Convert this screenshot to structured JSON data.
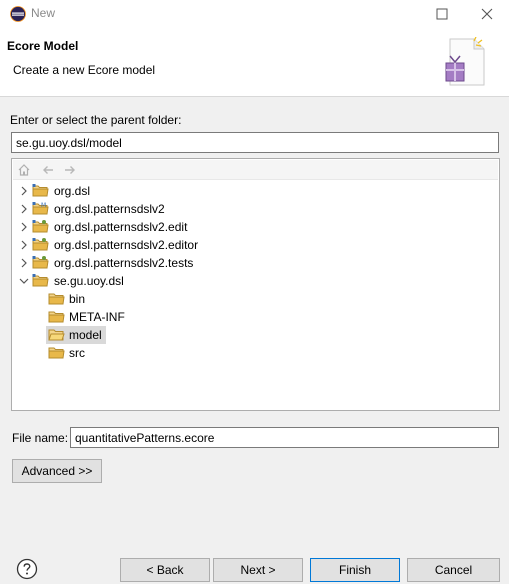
{
  "window": {
    "title": "New",
    "icons": [
      "eclipse-logo-icon",
      "maximize-icon",
      "close-icon"
    ]
  },
  "header": {
    "title": "Ecore Model",
    "description": "Create a new Ecore model",
    "icon": "new-ecore-wizard-icon"
  },
  "parent_folder": {
    "label": "Enter or select the parent folder:",
    "value": "se.gu.uoy.dsl/model"
  },
  "tree": {
    "toolbar_icons": [
      "home-icon",
      "back-arrow-icon",
      "forward-arrow-icon"
    ],
    "items": [
      {
        "label": "org.dsl",
        "level": 0,
        "expander": "collapsed",
        "icon": "project-folder-icon",
        "selected": false
      },
      {
        "label": "org.dsl.patternsdslv2",
        "level": 0,
        "expander": "collapsed",
        "icon": "project-folder-icon",
        "selected": false
      },
      {
        "label": "org.dsl.patternsdslv2.edit",
        "level": 0,
        "expander": "collapsed",
        "icon": "project-folder-icon",
        "selected": false
      },
      {
        "label": "org.dsl.patternsdslv2.editor",
        "level": 0,
        "expander": "collapsed",
        "icon": "project-folder-icon",
        "selected": false
      },
      {
        "label": "org.dsl.patternsdslv2.tests",
        "level": 0,
        "expander": "collapsed",
        "icon": "project-folder-icon",
        "selected": false
      },
      {
        "label": "se.gu.uoy.dsl",
        "level": 0,
        "expander": "expanded",
        "icon": "project-folder-icon",
        "selected": false
      },
      {
        "label": "bin",
        "level": 1,
        "expander": "none",
        "icon": "folder-icon",
        "selected": false
      },
      {
        "label": "META-INF",
        "level": 1,
        "expander": "none",
        "icon": "folder-icon",
        "selected": false
      },
      {
        "label": "model",
        "level": 1,
        "expander": "none",
        "icon": "open-folder-icon",
        "selected": true
      },
      {
        "label": "src",
        "level": 1,
        "expander": "none",
        "icon": "folder-icon",
        "selected": false
      }
    ]
  },
  "file_name": {
    "label": "File name:",
    "value": "quantitativePatterns.ecore"
  },
  "buttons": {
    "advanced": "Advanced >>",
    "back": "< Back",
    "next": "Next >",
    "finish": "Finish",
    "cancel": "Cancel",
    "help_icon": "help-icon"
  },
  "colors": {
    "selection": "#d9d9d9",
    "default_button_border": "#0078d7",
    "folder": "#e8b84a"
  }
}
